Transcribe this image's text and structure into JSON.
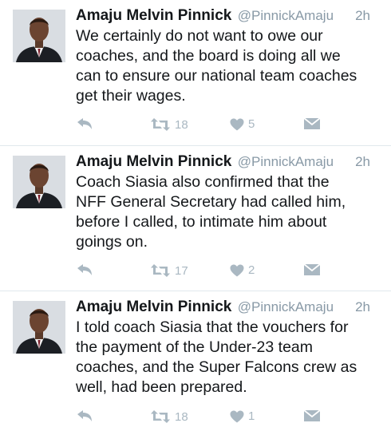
{
  "tweets": [
    {
      "author": "Amaju Melvin Pinnick",
      "handle": "@PinnickAmaju",
      "time": "2h",
      "text": "We certainly do not want to owe our\ncoaches, and the board is doing all we\ncan to ensure our national team coaches\nget their wages.",
      "retweets": "18",
      "likes": "5"
    },
    {
      "author": "Amaju Melvin Pinnick",
      "handle": "@PinnickAmaju",
      "time": "2h",
      "text": "Coach Siasia also confirmed that the\nNFF General Secretary had called him,\nbefore I called, to intimate him about\ngoings on.",
      "retweets": "17",
      "likes": "2"
    },
    {
      "author": "Amaju Melvin Pinnick",
      "handle": "@PinnickAmaju",
      "time": "2h",
      "text": "I told coach Siasia that the vouchers for\nthe payment of the Under-23 team\ncoaches, and the Super Falcons crew as\nwell, had been prepared.",
      "retweets": "18",
      "likes": "1"
    }
  ],
  "icons": {
    "reply": "reply-icon",
    "retweet": "retweet-icon",
    "like": "heart-icon",
    "dm": "direct-message-icon"
  },
  "colors": {
    "icon": "#aab8c2",
    "meta": "#8899a6",
    "text": "#14171a"
  }
}
